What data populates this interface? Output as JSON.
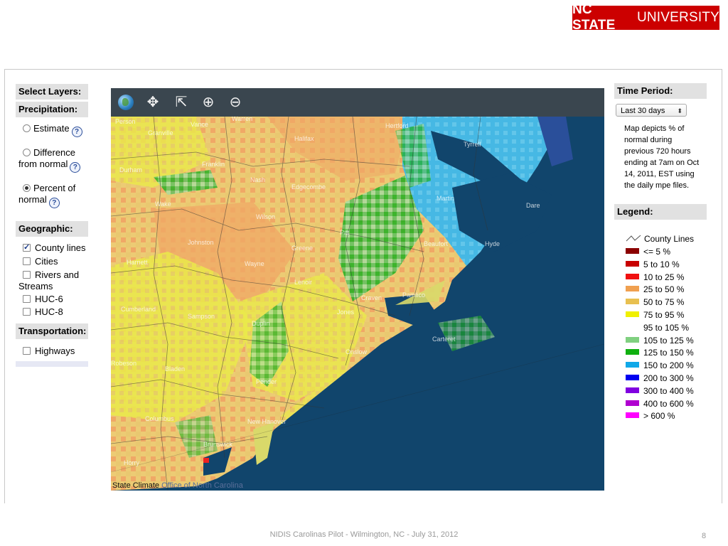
{
  "logo": {
    "bold": "NC STATE",
    "light": "UNIVERSITY"
  },
  "left_panel": {
    "select_layers": "Select Layers:",
    "precipitation": {
      "header": "Precipitation:",
      "options": [
        {
          "label": "Estimate",
          "selected": false
        },
        {
          "label_line1": "Difference",
          "label_line2": "from normal",
          "selected": false
        },
        {
          "label_line1": "Percent of",
          "label_line2": "normal",
          "selected": true
        }
      ]
    },
    "geographic": {
      "header": "Geographic:",
      "items": [
        {
          "label": "County lines",
          "checked": true
        },
        {
          "label": "Cities",
          "checked": false
        },
        {
          "label_line1": "Rivers and",
          "label_line2": "Streams",
          "checked": false
        },
        {
          "label": "HUC-6",
          "checked": false
        },
        {
          "label": "HUC-8",
          "checked": false
        }
      ]
    },
    "transportation": {
      "header": "Transportation:",
      "items": [
        {
          "label": "Highways",
          "checked": false
        }
      ]
    },
    "help_glyph": "?"
  },
  "map": {
    "toolbar_icons": [
      "globe-icon",
      "pan-icon",
      "zoom-box-icon",
      "zoom-in-icon",
      "zoom-out-icon"
    ],
    "toolbar_glyphs": {
      "pan": "✥",
      "zoom_box": "⇱",
      "zoom_in": "⊕",
      "zoom_out": "⊖"
    },
    "credit_text": "State Climate",
    "credit_faded": "Office of North Carolina",
    "county_labels": [
      "Person",
      "Vance",
      "Warren",
      "Granville",
      "Halifax",
      "Hertford",
      "Franklin",
      "Durham",
      "Nash",
      "Edgecombe",
      "Wake",
      "Wilson",
      "Pitt",
      "Johnston",
      "Greene",
      "Harnett",
      "Wayne",
      "Lenoir",
      "Craven",
      "Pamlico",
      "Cumberland",
      "Sampson",
      "Duplin",
      "Jones",
      "Onslow",
      "Carteret",
      "Bladen",
      "Pender",
      "Columbus",
      "New Hanover",
      "Brunswick",
      "Horry",
      "Robeson",
      "Tyrrell",
      "Hyde",
      "Dare",
      "Beaufort",
      "Martin"
    ]
  },
  "right_panel": {
    "time_period_header": "Time Period:",
    "time_period_value": "Last 30 days",
    "select_arrows": "⬍",
    "description_lines": [
      "Map depicts % of",
      "normal during",
      "previous 720 hours",
      "ending at 7am on Oct",
      "14, 2011, EST using",
      "the daily mpe files."
    ],
    "legend_header": "Legend:",
    "legend_lines_label": "County Lines",
    "legend": [
      {
        "label": "<= 5 %",
        "color": "#8b0000"
      },
      {
        "label": "5 to 10 %",
        "color": "#c80000"
      },
      {
        "label": "10 to 25 %",
        "color": "#f01010"
      },
      {
        "label": "25 to 50 %",
        "color": "#f0a050"
      },
      {
        "label": "50 to 75 %",
        "color": "#e8c050"
      },
      {
        "label": "75 to 95 %",
        "color": "#f0f000"
      },
      {
        "label": "95 to 105 %",
        "color": "#ffffff"
      },
      {
        "label": "105 to 125 %",
        "color": "#80d080"
      },
      {
        "label": "125 to 150 %",
        "color": "#10b010"
      },
      {
        "label": "150 to 200 %",
        "color": "#10a8e8"
      },
      {
        "label": "200 to 300 %",
        "color": "#0000f0"
      },
      {
        "label": "300 to 400 %",
        "color": "#8000e0"
      },
      {
        "label": "400 to 600 %",
        "color": "#b000d0"
      },
      {
        "label": "> 600 %",
        "color": "#ff00ff"
      }
    ]
  },
  "footer": {
    "text": "NIDIS Carolinas Pilot - Wilmington, NC - July 31, 2012",
    "page_number": "8"
  }
}
